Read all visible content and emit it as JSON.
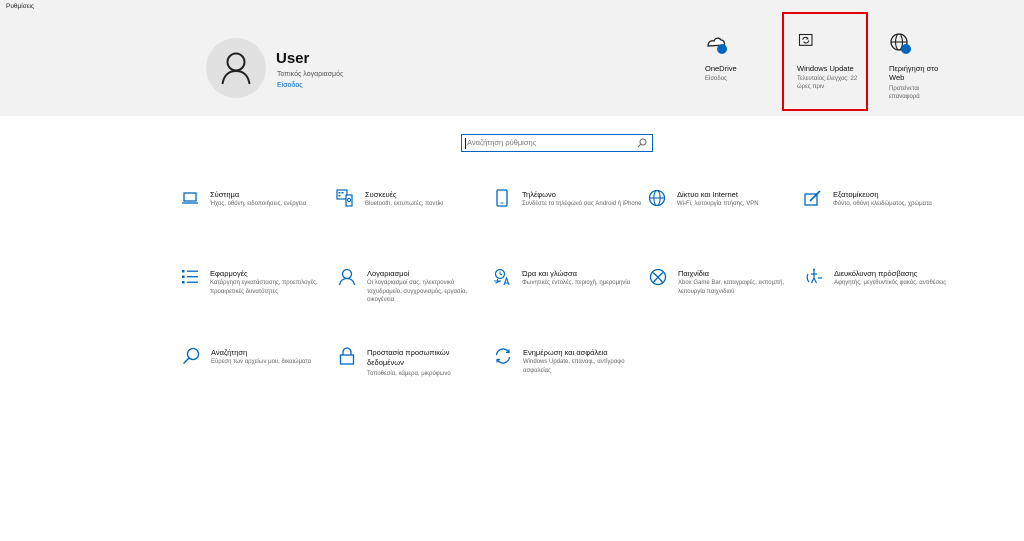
{
  "window": {
    "title": "Ρυθμίσεις"
  },
  "account": {
    "name": "User",
    "type": "Τοπικός λογαριασμός",
    "sign_in": "Είσοδος"
  },
  "header_items": [
    {
      "title": "OneDrive",
      "subtitle": "Είσοδος",
      "icon": "onedrive-icon"
    },
    {
      "title": "Windows Update",
      "subtitle": "Τελευταίος έλεγχος: 22 ώρες πριν",
      "icon": "windows-update-icon"
    },
    {
      "title": "Περιήγηση στο Web",
      "subtitle": "Προτείνεται επαναφορά",
      "icon": "globe-icon"
    }
  ],
  "search": {
    "placeholder": "Αναζήτηση ρύθμισης"
  },
  "categories": [
    {
      "title": "Σύστημα",
      "desc": "Ήχος, οθόνη, ειδοποιήσεις, ενέργεια",
      "icon": "laptop-icon"
    },
    {
      "title": "Συσκευές",
      "desc": "Bluetooth, εκτυπωτές, ποντίκι",
      "icon": "devices-icon"
    },
    {
      "title": "Τηλέφωνο",
      "desc": "Συνδέστε το τηλέφωνό σας Android ή iPhone",
      "icon": "phone-icon"
    },
    {
      "title": "Δίκτυο και Internet",
      "desc": "Wi-Fi, λειτουργία πτήσης, VPN",
      "icon": "globe-icon"
    },
    {
      "title": "Εξατομίκευση",
      "desc": "Φόντο, οθόνη κλειδώματος, χρώματα",
      "icon": "personalization-icon"
    },
    {
      "title": "Εφαρμογές",
      "desc": "Κατάργηση εγκατάστασης, προεπιλογές, προαιρετικές δυνατότητες",
      "icon": "apps-icon"
    },
    {
      "title": "Λογαριασμοί",
      "desc": "Οι λογαριασμοί σας, ηλεκτρονικό ταχυδρομείο, συγχρονισμός, εργασία, οικογένεια",
      "icon": "person-icon"
    },
    {
      "title": "Ώρα και γλώσσα",
      "desc": "Φωνητικές εντολές, περιοχή, ημερομηνία",
      "icon": "time-language-icon"
    },
    {
      "title": "Παιχνίδια",
      "desc": "Xbox Game Bar, καταγραφές, εκπομπή, λειτουργία παιχνιδιού",
      "icon": "xbox-icon"
    },
    {
      "title": "Διευκόλυνση πρόσβασης",
      "desc": "Αφηγητής, μεγεθυντικός φακός, αντιθέσεις",
      "icon": "accessibility-icon"
    },
    {
      "title": "Αναζήτηση",
      "desc": "Εύρεση των αρχείων μου, δικαιώματα",
      "icon": "search-icon"
    },
    {
      "title": "Προστασία προσωπικών δεδομένων",
      "desc": "Τοποθεσία, κάμερα, μικρόφωνο",
      "icon": "lock-icon"
    },
    {
      "title": "Ενημέρωση και ασφάλεια",
      "desc": "Windows Update, επαναφ., αντίγραφο ασφαλείας",
      "icon": "update-icon"
    }
  ],
  "colors": {
    "accent": "#0067c0",
    "header_bg": "#f2f2f2",
    "highlight": "#e00000"
  }
}
